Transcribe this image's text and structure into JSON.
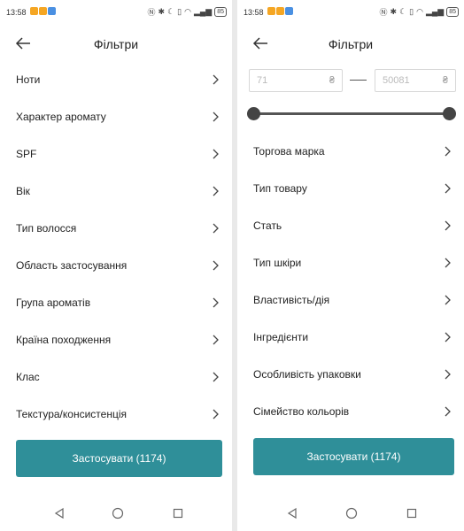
{
  "status": {
    "time": "13:58",
    "battery": "85"
  },
  "colors": {
    "accent": "#2f8f99"
  },
  "left": {
    "title": "Фільтри",
    "rows": [
      {
        "label": "Ноти"
      },
      {
        "label": "Характер аромату"
      },
      {
        "label": "SPF"
      },
      {
        "label": "Вік"
      },
      {
        "label": "Тип волосся"
      },
      {
        "label": "Область застосування"
      },
      {
        "label": "Група ароматів"
      },
      {
        "label": "Країна походження"
      },
      {
        "label": "Клас"
      },
      {
        "label": "Текстура/консистенція"
      }
    ],
    "apply_label": "Застосувати (1174)"
  },
  "right": {
    "title": "Фільтри",
    "price_min_placeholder": "71",
    "price_max_placeholder": "50081",
    "currency": "₴",
    "slider_range": {
      "min": 71,
      "max": 50081,
      "selected_min": 71,
      "selected_max": 50081
    },
    "rows": [
      {
        "label": "Торгова марка"
      },
      {
        "label": "Тип товару"
      },
      {
        "label": "Стать"
      },
      {
        "label": "Тип шкіри"
      },
      {
        "label": "Властивість/дія"
      },
      {
        "label": "Інгредієнти"
      },
      {
        "label": "Особливість упаковки"
      },
      {
        "label": "Сімейство кольорів"
      }
    ],
    "apply_label": "Застосувати (1174)"
  }
}
